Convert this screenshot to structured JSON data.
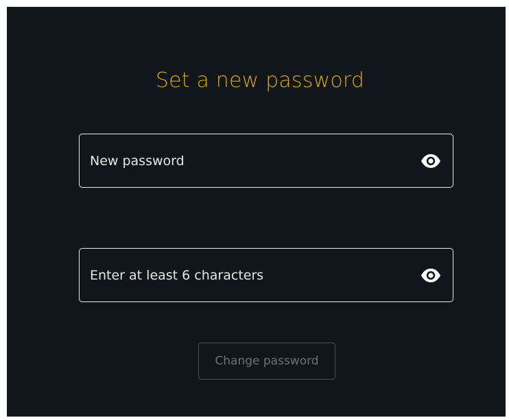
{
  "form": {
    "title": "Set a new password",
    "new_password": {
      "placeholder": "New password",
      "value": "",
      "icon": "eye-icon"
    },
    "confirm_password": {
      "placeholder": "Enter at least 6 characters",
      "value": "",
      "icon": "eye-icon"
    },
    "submit_label": "Change password"
  },
  "colors": {
    "background": "#11161a",
    "title": "#d9a41f",
    "field_border": "#e8e8e8",
    "button_disabled_text": "#6d7276",
    "button_disabled_border": "#4a4f53"
  }
}
